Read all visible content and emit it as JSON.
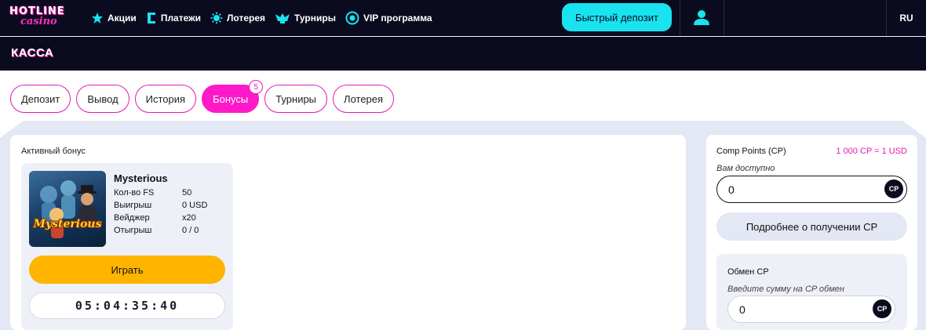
{
  "brand": {
    "logo_line1": "HOTLINE",
    "logo_line2": "casino"
  },
  "nav": {
    "items": [
      {
        "label": "Акции",
        "icon": "star-icon"
      },
      {
        "label": "Платежи",
        "icon": "payments-icon"
      },
      {
        "label": "Лотерея",
        "icon": "lottery-icon"
      },
      {
        "label": "Турниры",
        "icon": "tournament-icon"
      },
      {
        "label": "VIP программа",
        "icon": "vip-icon"
      }
    ],
    "quick_deposit": "Быстрый депозит",
    "lang": "RU"
  },
  "page": {
    "title": "КАССА"
  },
  "tabs": [
    {
      "label": "Депозит"
    },
    {
      "label": "Вывод"
    },
    {
      "label": "История"
    },
    {
      "label": "Бонусы",
      "badge": "5",
      "active": true
    },
    {
      "label": "Турниры"
    },
    {
      "label": "Лотерея"
    }
  ],
  "active_bonus": {
    "label": "Активный бонус",
    "game_title": "Mysterious",
    "image_text": "Mysterious",
    "stats": [
      {
        "key": "Кол-во FS",
        "value": "50"
      },
      {
        "key": "Выигрыш",
        "value": "0 USD"
      },
      {
        "key": "Вейджер",
        "value": "x20"
      },
      {
        "key": "Отыгрыш",
        "value": "0 / 0"
      }
    ],
    "play_label": "Играть",
    "timer": "05:04:35:40"
  },
  "comp_points": {
    "title": "Comp Points (CP)",
    "rate": "1 000 CP = 1 USD",
    "available_label": "Вам доступно",
    "available_value": "0",
    "icon_text": "CP",
    "more_label": "Подробнее о получении CP",
    "exchange": {
      "title": "Обмен CP",
      "hint": "Введите сумму на CP обмен",
      "value": "0",
      "icon_text": "CP"
    }
  },
  "colors": {
    "accent": "#ff19c8",
    "cyan": "#18e3ef",
    "gold": "#ffb400",
    "dark": "#0b0b1f"
  }
}
